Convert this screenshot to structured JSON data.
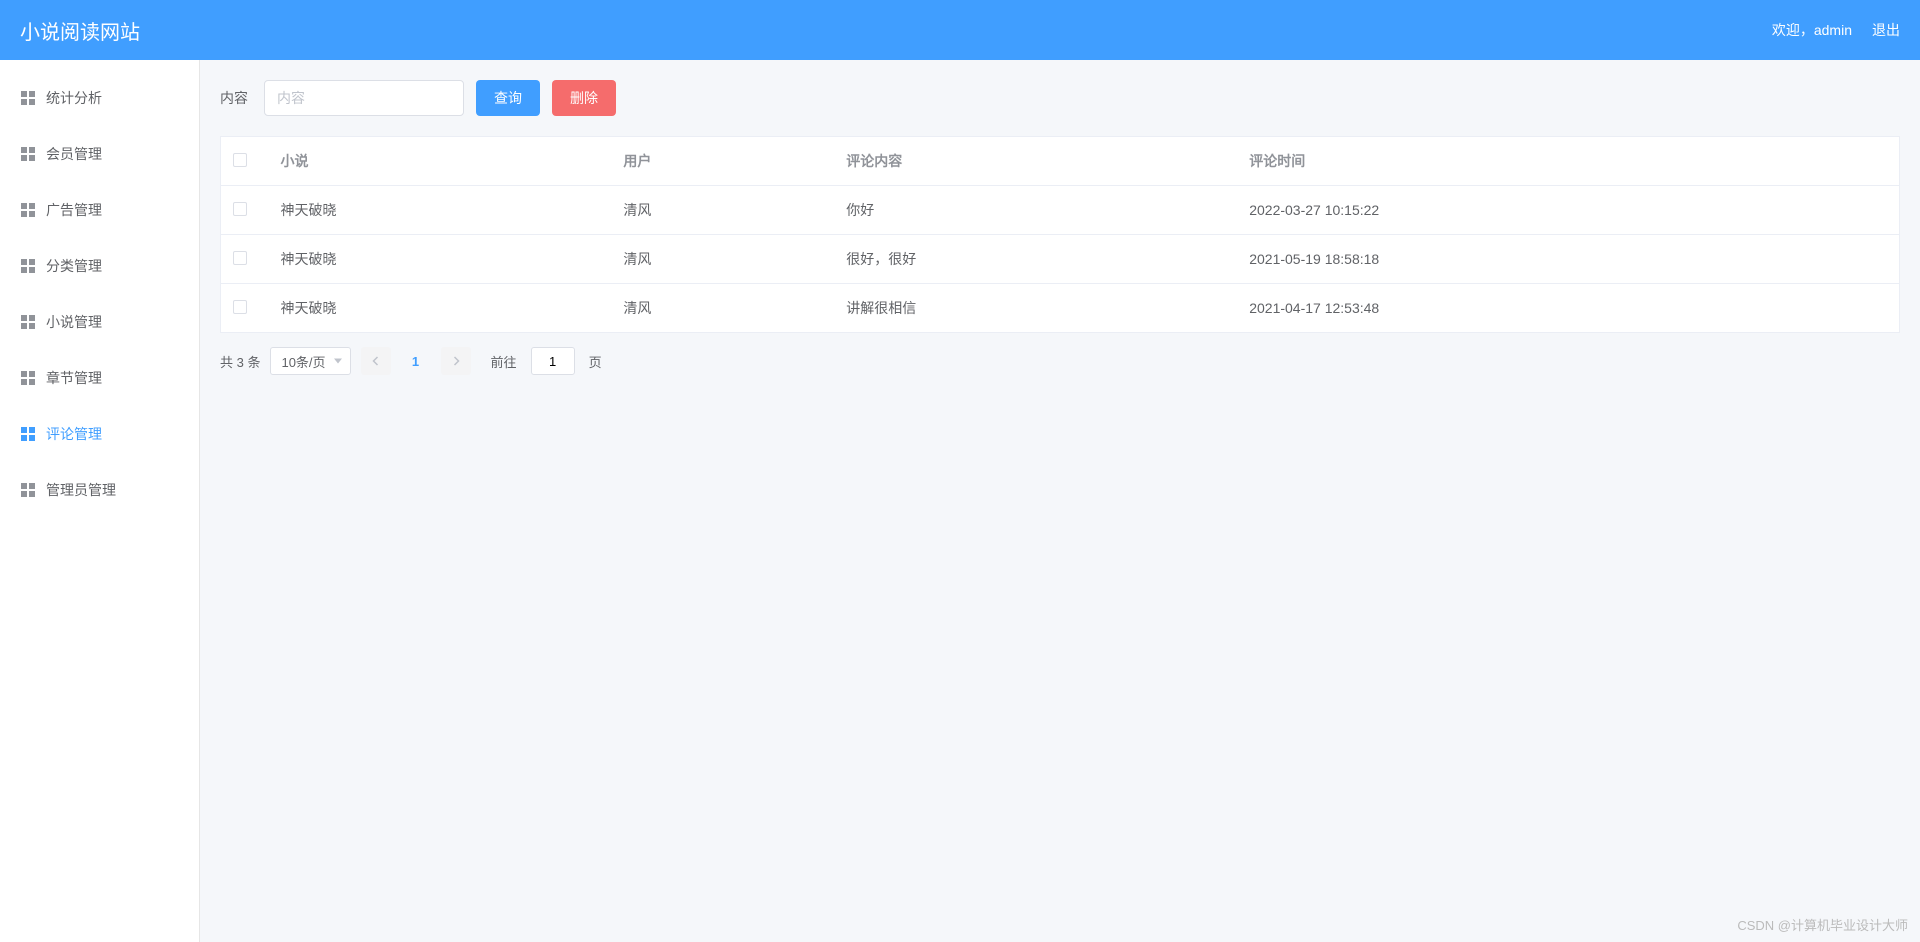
{
  "header": {
    "title": "小说阅读网站",
    "welcome": "欢迎，admin",
    "logout": "退出"
  },
  "sidebar": {
    "items": [
      {
        "label": "统计分析",
        "active": false
      },
      {
        "label": "会员管理",
        "active": false
      },
      {
        "label": "广告管理",
        "active": false
      },
      {
        "label": "分类管理",
        "active": false
      },
      {
        "label": "小说管理",
        "active": false
      },
      {
        "label": "章节管理",
        "active": false
      },
      {
        "label": "评论管理",
        "active": true
      },
      {
        "label": "管理员管理",
        "active": false
      }
    ]
  },
  "toolbar": {
    "content_label": "内容",
    "content_placeholder": "内容",
    "search_label": "查询",
    "delete_label": "删除"
  },
  "table": {
    "headers": {
      "novel": "小说",
      "user": "用户",
      "content": "评论内容",
      "time": "评论时间"
    },
    "rows": [
      {
        "novel": "神天破晓",
        "user": "清风",
        "content": "你好",
        "time": "2022-03-27 10:15:22"
      },
      {
        "novel": "神天破晓",
        "user": "清风",
        "content": "很好，很好",
        "time": "2021-05-19 18:58:18"
      },
      {
        "novel": "神天破晓",
        "user": "清风",
        "content": "讲解很相信",
        "time": "2021-04-17 12:53:48"
      }
    ]
  },
  "pagination": {
    "total_text": "共 3 条",
    "page_size": "10条/页",
    "current_page": "1",
    "jump_prefix": "前往",
    "jump_value": "1",
    "jump_suffix": "页"
  },
  "watermark": "CSDN @计算机毕业设计大师"
}
